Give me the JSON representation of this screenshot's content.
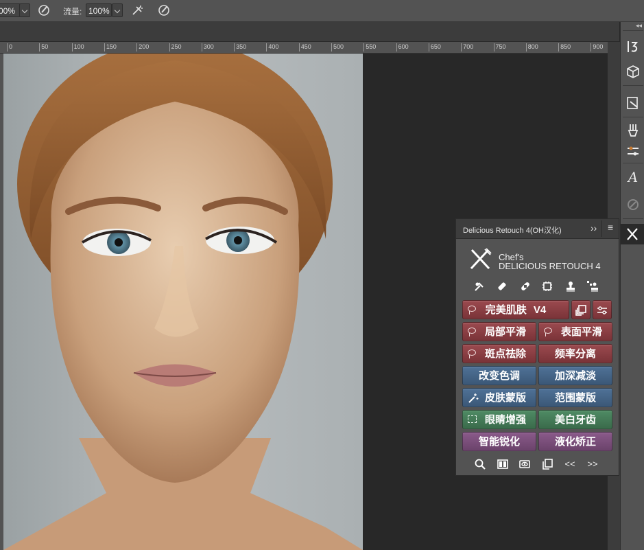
{
  "options_bar": {
    "opacity_value": "00%",
    "flow_label": "流量:",
    "flow_value": "100%"
  },
  "ruler": {
    "ticks": [
      "0",
      "50",
      "100",
      "150",
      "200",
      "250",
      "300",
      "350",
      "400",
      "450",
      "500",
      "550",
      "600",
      "650",
      "700",
      "750",
      "800",
      "850",
      "900"
    ]
  },
  "dock": {
    "collapse_glyph": "◂◂",
    "icons": [
      "history-icon",
      "3d-cube-icon",
      "properties-icon",
      "brushes-icon",
      "adjustments-icon",
      "character-icon",
      "clone-source-icon",
      "retouch-plugin-icon"
    ]
  },
  "panel": {
    "title": "Delicious Retouch 4(OH汉化)",
    "expand_glyph": "››",
    "menu_glyph": "≡",
    "brand_line1": "Chef's",
    "brand_line2": "DELICIOUS RETOUCH 4",
    "tool_icons": [
      "eyedropper-brush-icon",
      "healing-patch-icon",
      "bandage-icon",
      "chip-icon",
      "stamp-icon",
      "pattern-stamp-icon"
    ],
    "buttons": {
      "perfect_skin": "完美肌肤",
      "perfect_skin_version": "V4",
      "local_smooth": "局部平滑",
      "surface_smooth": "表面平滑",
      "spot_removal": "斑点祛除",
      "freq_separation": "频率分离",
      "change_tone": "改变色调",
      "dodge_burn": "加深减淡",
      "skin_mask": "皮肤蒙版",
      "range_mask": "范围蒙版",
      "eye_enhance": "眼睛增强",
      "teeth_whiten": "美白牙齿",
      "smart_sharpen": "智能锐化",
      "liquify": "液化矫正"
    },
    "bottom_icons": [
      "zoom-icon",
      "compare-icon",
      "view-icon",
      "copy-icon",
      "prev-icon",
      "next-icon"
    ],
    "prev_glyph": "<<",
    "next_glyph": ">>"
  },
  "colors": {
    "red": "#8a3f44",
    "blue": "#466685",
    "green": "#447c57",
    "purple": "#7b507b"
  }
}
